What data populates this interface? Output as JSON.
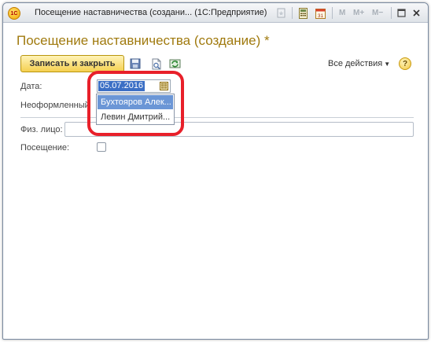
{
  "window": {
    "title": "Посещение наставничества (создани...  (1С:Предприятие)",
    "logo": "1С",
    "toolbar": {
      "memory_labels": [
        "M",
        "M+",
        "M−"
      ],
      "calendar_day": "31"
    }
  },
  "form": {
    "title": "Посещение наставничества (создание) *",
    "save_close_label": "Записать и закрыть",
    "all_actions_label": "Все действия",
    "help_label": "?"
  },
  "fields": {
    "date_label": "Дата:",
    "date_value": "05.07.2016",
    "unformalized_label": "Неоформленный",
    "person_label": "Физ. лицо:",
    "person_value": "",
    "visit_label": "Посещение:",
    "visit_checked": false
  },
  "dropdown": {
    "items": [
      "Бухтояров Алек...",
      "Левин Дмитрий..."
    ],
    "selected_index": 0
  },
  "colors": {
    "accent": "#a07a0e",
    "primary_button": "#f5d050",
    "selection": "#3b6fc5",
    "highlight": "#e8202a"
  }
}
